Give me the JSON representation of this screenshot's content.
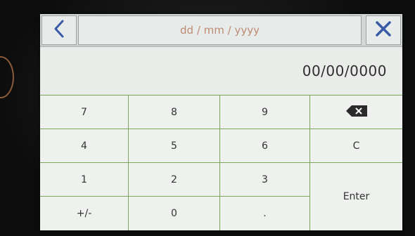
{
  "header": {
    "title": "dd / mm / yyyy",
    "back_icon": "chevron-left-icon",
    "close_icon": "close-icon"
  },
  "display": {
    "value": "00/00/0000"
  },
  "keypad": {
    "rows": [
      [
        "7",
        "8",
        "9",
        "backspace"
      ],
      [
        "4",
        "5",
        "6",
        "C"
      ],
      [
        "1",
        "2",
        "3",
        "Enter"
      ],
      [
        "+/-",
        "0",
        ".",
        ""
      ]
    ],
    "key_labels": {
      "k7": "7",
      "k8": "8",
      "k9": "9",
      "k4": "4",
      "k5": "5",
      "k6": "6",
      "clear": "C",
      "k1": "1",
      "k2": "2",
      "k3": "3",
      "enter": "Enter",
      "plusminus": "+/-",
      "k0": "0",
      "dot": "."
    },
    "backspace_icon": "backspace-icon"
  },
  "colors": {
    "accent_blue": "#3a5aa8",
    "grid_green": "#7ea55f",
    "title_text": "#c08a74"
  }
}
